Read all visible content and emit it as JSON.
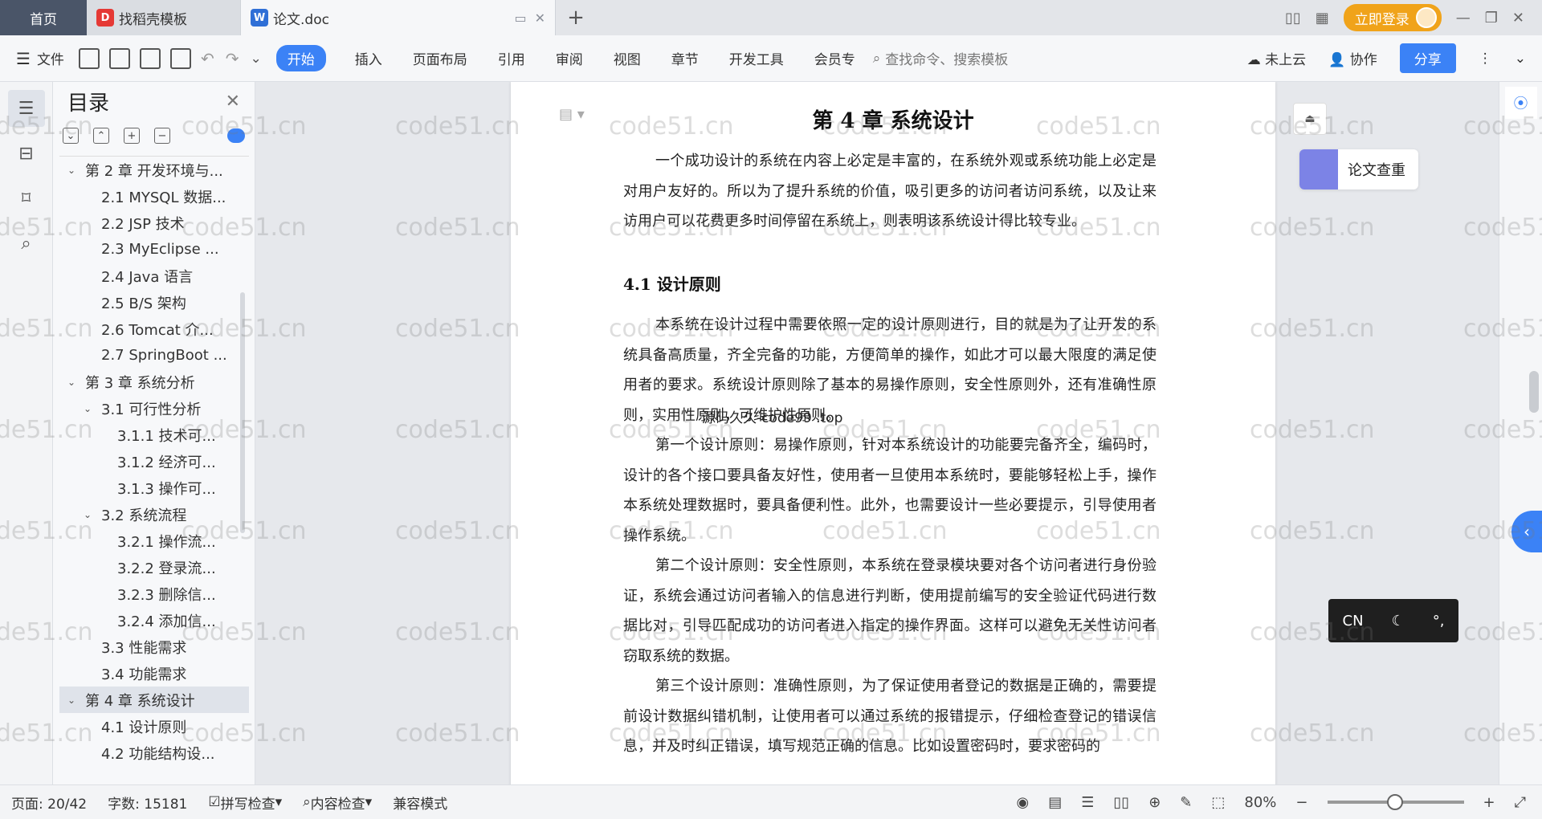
{
  "titlebar": {
    "home": "首页",
    "tabs": [
      {
        "label": "找稻壳模板"
      },
      {
        "label": "论文.doc"
      }
    ],
    "login": "立即登录"
  },
  "ribbon": {
    "file": "文件",
    "menus": [
      "开始",
      "插入",
      "页面布局",
      "引用",
      "审阅",
      "视图",
      "章节",
      "开发工具",
      "会员专"
    ],
    "search_placeholder": "查找命令、搜索模板",
    "cloud": "未上云",
    "collab": "协作",
    "share": "分享"
  },
  "toc": {
    "title": "目录",
    "items": [
      {
        "label": "第 2 章  开发环境与...",
        "level": 0,
        "expanded": true
      },
      {
        "label": "2.1 MYSQL 数据...",
        "level": 1
      },
      {
        "label": "2.2 JSP 技术",
        "level": 1
      },
      {
        "label": "2.3 MyEclipse ...",
        "level": 1
      },
      {
        "label": "2.4 Java 语言",
        "level": 1
      },
      {
        "label": "2.5 B/S 架构",
        "level": 1
      },
      {
        "label": "2.6 Tomcat 介...",
        "level": 1
      },
      {
        "label": "2.7 SpringBoot ...",
        "level": 1
      },
      {
        "label": "第 3 章  系统分析",
        "level": 0,
        "expanded": true
      },
      {
        "label": "3.1 可行性分析",
        "level": 1,
        "expanded": true
      },
      {
        "label": "3.1.1 技术可...",
        "level": 2
      },
      {
        "label": "3.1.2 经济可...",
        "level": 2
      },
      {
        "label": "3.1.3 操作可...",
        "level": 2
      },
      {
        "label": "3.2 系统流程",
        "level": 1,
        "expanded": true
      },
      {
        "label": "3.2.1 操作流...",
        "level": 2
      },
      {
        "label": "3.2.2 登录流...",
        "level": 2
      },
      {
        "label": "3.2.3 删除信...",
        "level": 2
      },
      {
        "label": "3.2.4 添加信...",
        "level": 2
      },
      {
        "label": "3.3 性能需求",
        "level": 1
      },
      {
        "label": "3.4 功能需求",
        "level": 1
      },
      {
        "label": "第 4 章  系统设计",
        "level": 0,
        "expanded": true,
        "active": true
      },
      {
        "label": "4.1 设计原则",
        "level": 1
      },
      {
        "label": "4.2 功能结构设...",
        "level": 1
      }
    ]
  },
  "document": {
    "chapter_title": "第 4 章  系统设计",
    "intro": "一个成功设计的系统在内容上必定是丰富的，在系统外观或系统功能上必定是对用户友好的。所以为了提升系统的价值，吸引更多的访问者访问系统，以及让来访用户可以花费更多时间停留在系统上，则表明该系统设计得比较专业。",
    "section_title": "4.1  设计原则",
    "p1": "本系统在设计过程中需要依照一定的设计原则进行，目的就是为了让开发的系统具备高质量，齐全完备的功能，方便简单的操作，如此才可以最大限度的满足使用者的要求。系统设计原则除了基本的易操作原则，安全性原则外，还有准确性原则，实用性原则，可维护性原则。",
    "p2": "第一个设计原则：易操作原则，针对本系统设计的功能要完备齐全，编码时，设计的各个接口要具备友好性，使用者一旦使用本系统时，要能够轻松上手，操作本系统处理数据时，要具备便利性。此外，也需要设计一些必要提示，引导使用者操作系统。",
    "p3": "第二个设计原则：安全性原则，本系统在登录模块要对各个访问者进行身份验证，系统会通过访问者输入的信息进行判断，使用提前编写的安全验证代码进行数据比对，引导匹配成功的访问者进入指定的操作界面。这样可以避免无关性访问者窃取系统的数据。",
    "p4": "第三个设计原则：准确性原则，为了保证使用者登记的数据是正确的，需要提前设计数据纠错机制，让使用者可以通过系统的报错提示，仔细检查登记的错误信息，并及时纠正错误，填写规范正确的信息。比如设置密码时，要求密码的",
    "overlay": "源码久久-code99 .top"
  },
  "float": {
    "check": "论文查重",
    "ime_lang": "CN"
  },
  "status": {
    "page": "页面: 20/42",
    "words": "字数: 15181",
    "spell": "拼写检查",
    "content": "内容检查",
    "compat": "兼容模式",
    "zoom": "80%"
  },
  "watermark": "code51.cn"
}
